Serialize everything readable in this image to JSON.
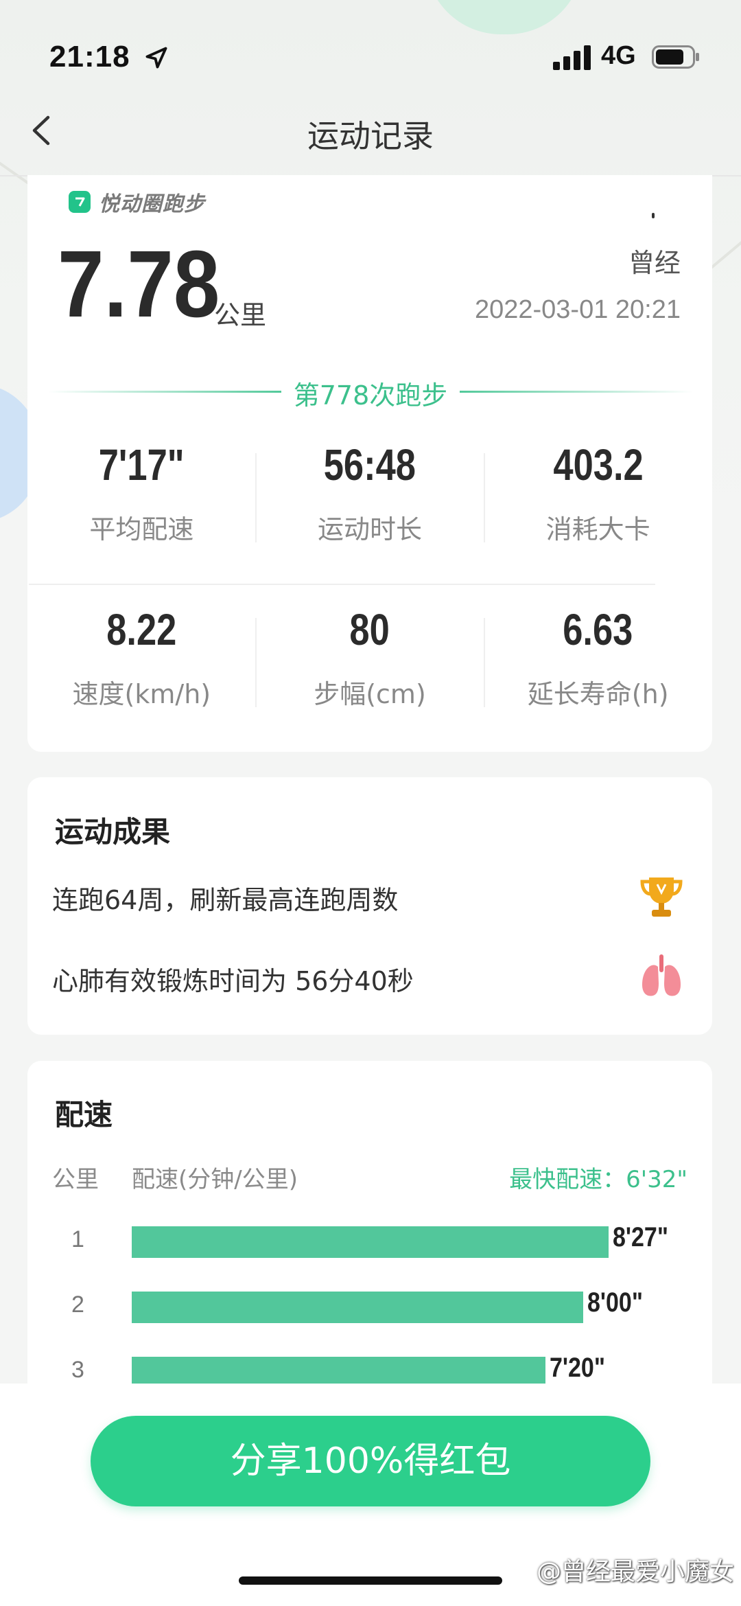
{
  "status_bar": {
    "time": "21:18",
    "network": "4G"
  },
  "nav": {
    "title": "运动记录"
  },
  "summary": {
    "brand": "悦动圈跑步",
    "distance": "7.78",
    "distance_unit": "公里",
    "user_name": "曾经",
    "date": "2022-03-01 20:21",
    "run_count": "第778次跑步",
    "stats": [
      {
        "value": "7'17\"",
        "label": "平均配速"
      },
      {
        "value": "56:48",
        "label": "运动时长"
      },
      {
        "value": "403.2",
        "label": "消耗大卡"
      },
      {
        "value": "8.22",
        "label": "速度(km/h)"
      },
      {
        "value": "80",
        "label": "步幅(cm)"
      },
      {
        "value": "6.63",
        "label": "延长寿命(h)"
      }
    ]
  },
  "results": {
    "title": "运动成果",
    "items": [
      {
        "text": "连跑64周，刷新最高连跑周数",
        "icon": "trophy-icon"
      },
      {
        "text": "心肺有效锻炼时间为 56分40秒",
        "icon": "lungs-icon"
      }
    ]
  },
  "pace": {
    "title": "配速",
    "col_km": "公里",
    "col_pace": "配速(分钟/公里)",
    "fastest": "最快配速：6'32\"",
    "rows": [
      {
        "km": "1",
        "pace": "8'27\"",
        "fraction": 1.0
      },
      {
        "km": "2",
        "pace": "8'00\"",
        "fraction": 0.947
      },
      {
        "km": "3",
        "pace": "7'20\"",
        "fraction": 0.867
      }
    ]
  },
  "share_button": "分享100%得红包",
  "watermark": "@曾经最爱小魔女",
  "colors": {
    "accent": "#2ccf8c",
    "bar": "#52c79b",
    "text_muted": "#888888"
  }
}
